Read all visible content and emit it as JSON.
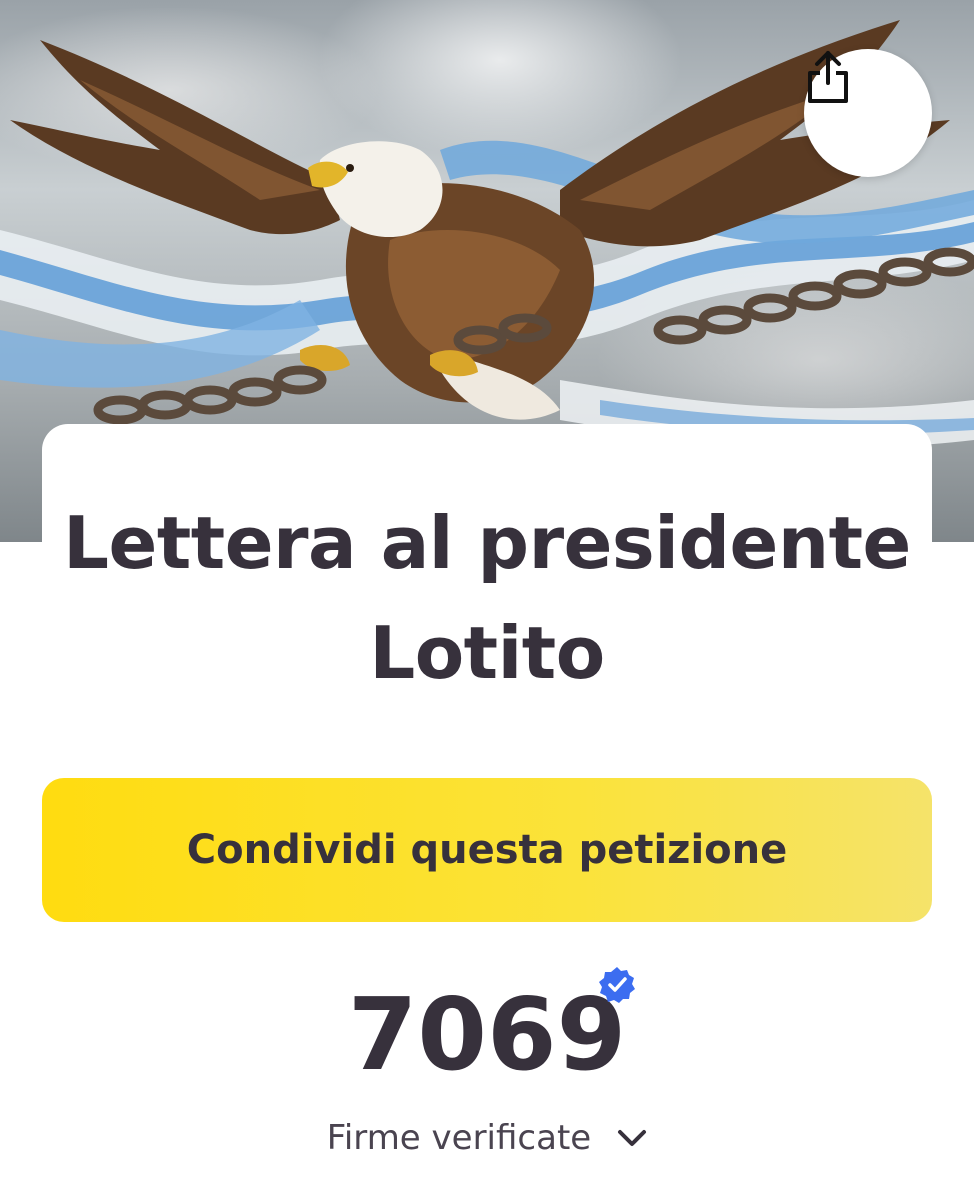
{
  "hero": {
    "image_description_icon": "eagle-banner-image"
  },
  "actions": {
    "share_icon": "share-icon"
  },
  "petition": {
    "title": "Lettera al presidente Lotito",
    "share_button_label": "Condividi questa petizione",
    "signature_count": "7069",
    "signature_label": "Firme verificate",
    "verified_icon": "verified-badge-icon",
    "expand_icon": "chevron-down-icon"
  },
  "colors": {
    "accent_yellow": "#ffdc10",
    "text_dark": "#37313c",
    "verified_blue": "#3c6df0"
  }
}
